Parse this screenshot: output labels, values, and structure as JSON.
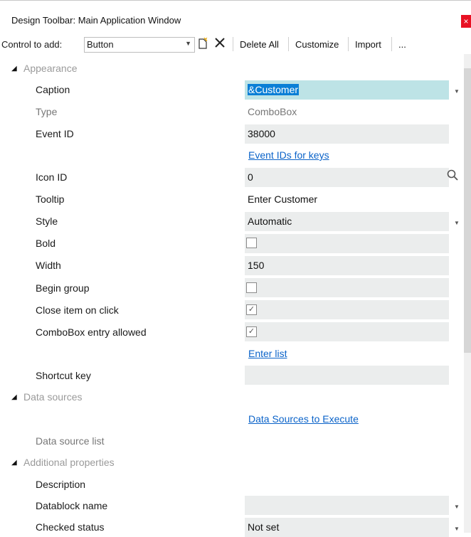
{
  "window": {
    "title": "Design Toolbar: Main Application Window",
    "close_glyph": "×"
  },
  "toolbar": {
    "control_label": "Control to add:",
    "control_value": "Button",
    "delete_all": "Delete All",
    "customize": "Customize",
    "import": "Import",
    "more": "..."
  },
  "props": {
    "appearance": "Appearance",
    "caption_label": "Caption",
    "caption_value": "&Customer",
    "type_label": "Type",
    "type_value": "ComboBox",
    "event_label": "Event ID",
    "event_value": "38000",
    "event_link": "Event IDs for keys",
    "icon_label": "Icon ID",
    "icon_value": "0",
    "tooltip_label": "Tooltip",
    "tooltip_value": "Enter Customer",
    "style_label": "Style",
    "style_value": "Automatic",
    "bold_label": "Bold",
    "width_label": "Width",
    "width_value": "150",
    "begin_label": "Begin group",
    "close_label": "Close item on click",
    "combo_label": "ComboBox entry allowed",
    "enter_list": "Enter list",
    "shortcut_label": "Shortcut key",
    "data_sources": "Data sources",
    "ds_link": "Data Sources to Execute",
    "ds_list_label": "Data source list",
    "additional": "Additional properties",
    "desc_label": "Description",
    "datablock_label": "Datablock name",
    "checked_label": "Checked status",
    "checked_value": "Not set"
  },
  "checkboxes": {
    "bold": false,
    "begin_group": false,
    "close_on_click": true,
    "combo_entry": true
  }
}
